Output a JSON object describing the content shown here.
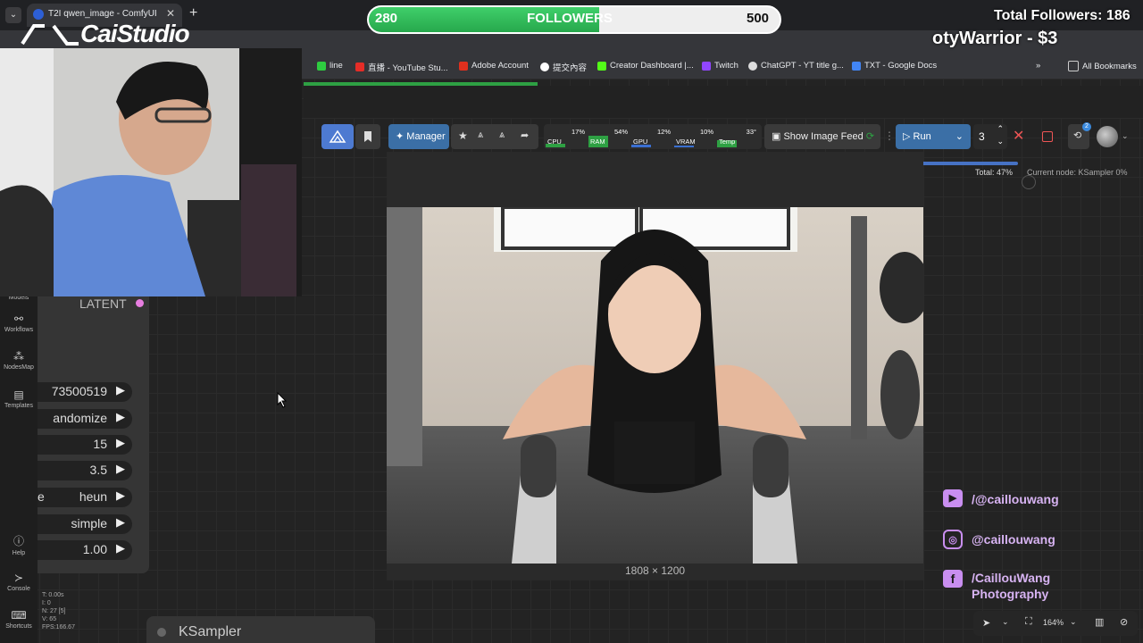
{
  "browser": {
    "tab_title": "T2I qwen_image - ComfyUI",
    "bookmarks": [
      "line",
      "直播 - YouTube Stu...",
      "Adobe Account",
      "提交內容",
      "Creator Dashboard |...",
      "Twitch",
      "ChatGPT - YT title g...",
      "TXT - Google Docs"
    ],
    "all_bookmarks": "All Bookmarks"
  },
  "toolbar": {
    "manager_label": "Manager",
    "monitor": [
      {
        "label": "CPU",
        "pct": "17%"
      },
      {
        "label": "RAM",
        "pct": "54%"
      },
      {
        "label": "GPU",
        "pct": "12%"
      },
      {
        "label": "VRAM",
        "pct": "10%"
      },
      {
        "label": "Temp",
        "pct": "33°"
      }
    ],
    "show_feed_label": "Show Image Feed",
    "run_label": "Run",
    "run_count": "3",
    "queue_badge": "2"
  },
  "progress": {
    "total": "Total: 47%",
    "current_node": "Current node: KSampler 0%"
  },
  "sidebar": {
    "items": [
      {
        "label": "Models",
        "icon": "cube-icon"
      },
      {
        "label": "Workflows",
        "icon": "workflow-icon"
      },
      {
        "label": "NodesMap",
        "icon": "nodes-map-icon"
      },
      {
        "label": "Templates",
        "icon": "templates-icon"
      },
      {
        "label": "Help",
        "icon": "help-icon"
      },
      {
        "label": "Console",
        "icon": "console-icon"
      },
      {
        "label": "Shortcuts",
        "icon": "keyboard-icon"
      }
    ]
  },
  "node": {
    "output_label": "LATENT",
    "widgets": [
      {
        "label": "",
        "value": "73500519"
      },
      {
        "label": "",
        "value": "andomize"
      },
      {
        "label": "",
        "value": "15"
      },
      {
        "label": "",
        "value": "3.5"
      },
      {
        "label": "e",
        "value": "heun"
      },
      {
        "label": "",
        "value": "simple"
      },
      {
        "label": "",
        "value": "1.00"
      }
    ],
    "ksampler_title": "KSampler"
  },
  "stats": [
    "T: 0.00s",
    "I: 0",
    "N: 27 [5]",
    "V: 65",
    "FPS:166.67"
  ],
  "preview": {
    "size_label": "1808 × 1200"
  },
  "overlay": {
    "followers_current": "280",
    "followers_label": "FOLLOWERS",
    "followers_goal": "500",
    "followers_progress": 0.56,
    "total_followers": "Total Followers: 186",
    "donation": "otyWarrior - $3",
    "logo_text": "CaiStudio",
    "socials": [
      {
        "icon": "youtube-icon",
        "text": "/@caillouwang"
      },
      {
        "icon": "instagram-icon",
        "text": "@caillouwang"
      },
      {
        "icon": "facebook-icon",
        "text": "/CaillouWang Photography"
      }
    ]
  },
  "canvas_controls": {
    "zoom": "164%"
  },
  "colors": {
    "accent": "#3b6fa6",
    "follow_green": "#2ea043",
    "social_purple": "#d7b3f2"
  }
}
